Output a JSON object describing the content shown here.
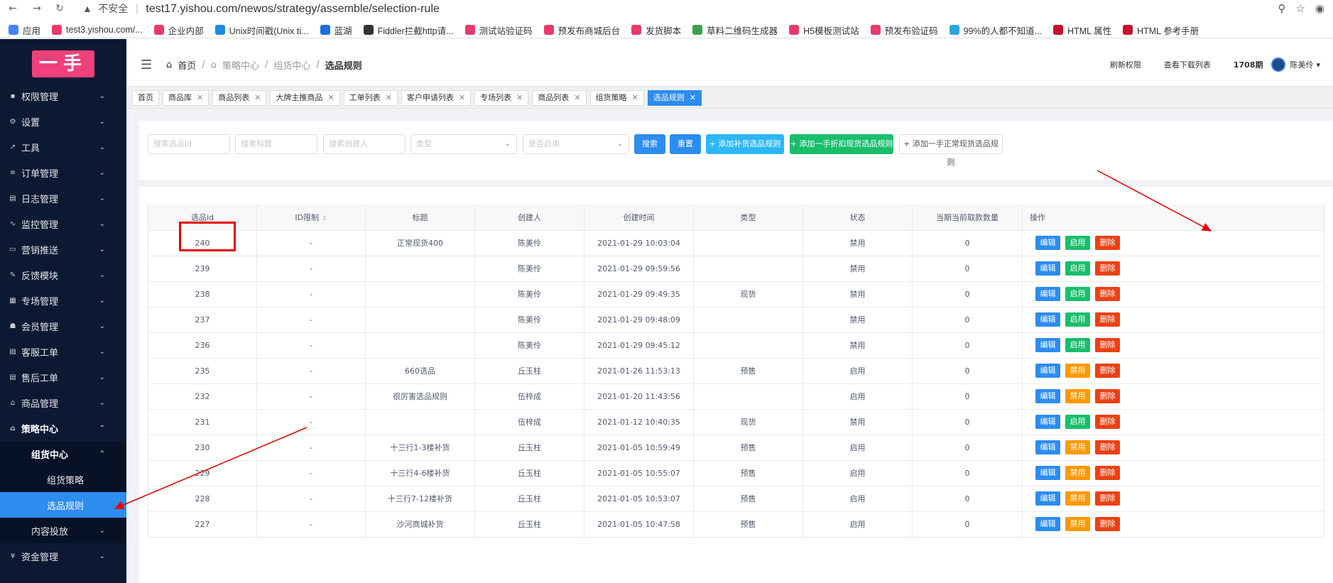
{
  "browser": {
    "warning_icon": "warning-triangle-icon",
    "insecure_label": "不安全",
    "url": "test17.yishou.com/newos/strategy/assemble/selection-rule",
    "bookmarks": [
      {
        "label": "应用",
        "color": "#4285f4"
      },
      {
        "label": "test3.yishou.com/...",
        "color": "#e83a6b"
      },
      {
        "label": "企业内部",
        "color": "#e83a6b"
      },
      {
        "label": "Unix时间戳(Unix ti...",
        "color": "#1e88e5"
      },
      {
        "label": "蓝湖",
        "color": "#1e6fd9"
      },
      {
        "label": "Fiddler拦截http请...",
        "color": "#333333"
      },
      {
        "label": "测试站验证码",
        "color": "#e83a6b"
      },
      {
        "label": "预发布商城后台",
        "color": "#e83a6b"
      },
      {
        "label": "发货脚本",
        "color": "#e83a6b"
      },
      {
        "label": "草料二维码生成器",
        "color": "#3aa14a"
      },
      {
        "label": "H5模板测试站",
        "color": "#e83a6b"
      },
      {
        "label": "预发布验证码",
        "color": "#e83a6b"
      },
      {
        "label": "99%的人都不知道...",
        "color": "#29a8e0"
      },
      {
        "label": "HTML 属性",
        "color": "#c8102e"
      },
      {
        "label": "HTML 参考手册",
        "color": "#c8102e"
      }
    ]
  },
  "logo": "一手",
  "sidebar": {
    "items": [
      {
        "label": "权限管理",
        "icon": "lock-icon",
        "glyph": "▪"
      },
      {
        "label": "设置",
        "icon": "gear-icon",
        "glyph": "⚙"
      },
      {
        "label": "工具",
        "icon": "wrench-icon",
        "glyph": "↗"
      },
      {
        "label": "订单管理",
        "icon": "list-icon",
        "glyph": "≡"
      },
      {
        "label": "日志管理",
        "icon": "log-icon",
        "glyph": "▤"
      },
      {
        "label": "监控管理",
        "icon": "pulse-icon",
        "glyph": "∿"
      },
      {
        "label": "营销推送",
        "icon": "message-icon",
        "glyph": "▭"
      },
      {
        "label": "反馈模块",
        "icon": "feedback-icon",
        "glyph": "✎"
      },
      {
        "label": "专场管理",
        "icon": "grid-icon",
        "glyph": "▦"
      },
      {
        "label": "会员管理",
        "icon": "people-icon",
        "glyph": "☗"
      },
      {
        "label": "客服工单",
        "icon": "ticket-icon",
        "glyph": "▤"
      },
      {
        "label": "售后工单",
        "icon": "ticket-icon",
        "glyph": "▤"
      },
      {
        "label": "商品管理",
        "icon": "product-icon",
        "glyph": "⌂"
      },
      {
        "label": "策略中心",
        "icon": "strategy-icon",
        "glyph": "⌂"
      }
    ],
    "sub_group": "组货中心",
    "sub_items": [
      "组货策略",
      "选品规则"
    ],
    "after_items": [
      {
        "label": "内容投放",
        "level": "sub"
      },
      {
        "label": "资金管理",
        "icon": "money-icon",
        "glyph": "¥",
        "level": "top"
      }
    ]
  },
  "header": {
    "breadcrumb": [
      "首页",
      "策略中心",
      "组货中心",
      "选品规则"
    ],
    "refresh": "刷新权限",
    "downloads": "查看下载列表",
    "period": "1708期",
    "user": "陈美伶"
  },
  "tabs": [
    "首页",
    "商品库",
    "商品列表",
    "大牌主推商品",
    "工单列表",
    "客户申请列表",
    "专场列表",
    "商品列表",
    "组货策略",
    "选品规则"
  ],
  "filters": {
    "search_id": "搜索选品id",
    "search_title": "搜索标题",
    "search_creator": "搜索创建人",
    "type": "类型",
    "enabled": "是否启用",
    "search_btn": "搜索",
    "reset_btn": "重置",
    "add_restock": "+ 添加补货选品规则",
    "add_discount": "+ 添加一手折扣现货选品规则",
    "add_normal": "+ 添加一手正常现货选品规则"
  },
  "table": {
    "columns": [
      "选品id",
      "ID限制",
      "标题",
      "创建人",
      "创建时间",
      "类型",
      "状态",
      "当期当前取款数量",
      "操作"
    ],
    "actions": {
      "edit": "编辑",
      "enable": "启用",
      "disable": "禁用",
      "delete": "删除"
    },
    "rows": [
      {
        "id": "240",
        "limit": "-",
        "title": "正常现货400",
        "creator": "陈美伶",
        "time": "2021-01-29 10:03:04",
        "type": "",
        "status": "禁用",
        "count": "0",
        "toggle": "启用"
      },
      {
        "id": "239",
        "limit": "-",
        "title": "",
        "creator": "陈美伶",
        "time": "2021-01-29 09:59:56",
        "type": "",
        "status": "禁用",
        "count": "0",
        "toggle": "启用"
      },
      {
        "id": "238",
        "limit": "-",
        "title": "",
        "creator": "陈美伶",
        "time": "2021-01-29 09:49:35",
        "type": "现货",
        "status": "禁用",
        "count": "0",
        "toggle": "启用"
      },
      {
        "id": "237",
        "limit": "-",
        "title": "",
        "creator": "陈美伶",
        "time": "2021-01-29 09:48:09",
        "type": "",
        "status": "禁用",
        "count": "0",
        "toggle": "启用"
      },
      {
        "id": "236",
        "limit": "-",
        "title": "",
        "creator": "陈美伶",
        "time": "2021-01-29 09:45:12",
        "type": "",
        "status": "禁用",
        "count": "0",
        "toggle": "启用"
      },
      {
        "id": "235",
        "limit": "-",
        "title": "660选品",
        "creator": "丘玉柱",
        "time": "2021-01-26 11:53:13",
        "type": "预售",
        "status": "启用",
        "count": "0",
        "toggle": "禁用"
      },
      {
        "id": "232",
        "limit": "-",
        "title": "很厉害选品规则",
        "creator": "伍梓成",
        "time": "2021-01-20 11:43:56",
        "type": "",
        "status": "启用",
        "count": "0",
        "toggle": "禁用"
      },
      {
        "id": "231",
        "limit": "-",
        "title": "",
        "creator": "伍梓成",
        "time": "2021-01-12 10:40:35",
        "type": "现货",
        "status": "禁用",
        "count": "0",
        "toggle": "启用"
      },
      {
        "id": "230",
        "limit": "-",
        "title": "十三行1-3楼补货",
        "creator": "丘玉柱",
        "time": "2021-01-05 10:59:49",
        "type": "预售",
        "status": "启用",
        "count": "0",
        "toggle": "禁用"
      },
      {
        "id": "229",
        "limit": "-",
        "title": "十三行4-6楼补货",
        "creator": "丘玉柱",
        "time": "2021-01-05 10:55:07",
        "type": "预售",
        "status": "启用",
        "count": "0",
        "toggle": "禁用"
      },
      {
        "id": "228",
        "limit": "-",
        "title": "十三行7-12楼补货",
        "creator": "丘玉柱",
        "time": "2021-01-05 10:53:07",
        "type": "预售",
        "status": "启用",
        "count": "0",
        "toggle": "禁用"
      },
      {
        "id": "227",
        "limit": "-",
        "title": "沙河商城补货",
        "creator": "丘玉柱",
        "time": "2021-01-05 10:47:58",
        "type": "预售",
        "status": "启用",
        "count": "0",
        "toggle": "禁用"
      }
    ]
  },
  "colors": {
    "primary": "#2d8cf0",
    "success": "#19be6b",
    "warning": "#ff9900",
    "danger": "#ed4014",
    "sidebar": "#0b1933",
    "annotation": "#e60000"
  }
}
